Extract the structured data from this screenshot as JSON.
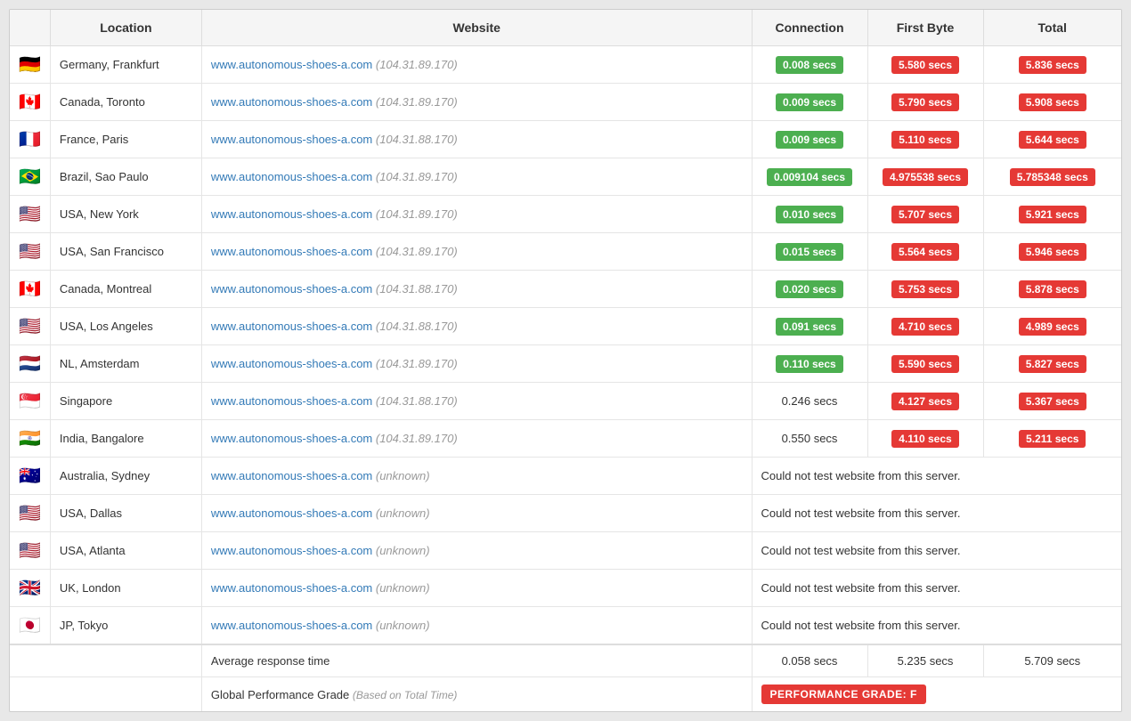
{
  "table": {
    "headers": [
      "",
      "Location",
      "Website",
      "Connection",
      "First Byte",
      "Total"
    ],
    "rows": [
      {
        "flag": "🇩🇪",
        "location": "Germany, Frankfurt",
        "website_main": "www.autonomous-shoes-a.com",
        "website_ip": "(104.31.89.170)",
        "connection": "0.008 secs",
        "connection_type": "green",
        "first_byte": "5.580 secs",
        "first_byte_type": "red",
        "total": "5.836 secs",
        "total_type": "red"
      },
      {
        "flag": "🇨🇦",
        "location": "Canada, Toronto",
        "website_main": "www.autonomous-shoes-a.com",
        "website_ip": "(104.31.89.170)",
        "connection": "0.009 secs",
        "connection_type": "green",
        "first_byte": "5.790 secs",
        "first_byte_type": "red",
        "total": "5.908 secs",
        "total_type": "red"
      },
      {
        "flag": "🇫🇷",
        "location": "France, Paris",
        "website_main": "www.autonomous-shoes-a.com",
        "website_ip": "(104.31.88.170)",
        "connection": "0.009 secs",
        "connection_type": "green",
        "first_byte": "5.110 secs",
        "first_byte_type": "red",
        "total": "5.644 secs",
        "total_type": "red"
      },
      {
        "flag": "🇧🇷",
        "location": "Brazil, Sao Paulo",
        "website_main": "www.autonomous-shoes-a.com",
        "website_ip": "(104.31.89.170)",
        "connection": "0.009104 secs",
        "connection_type": "green",
        "first_byte": "4.975538 secs",
        "first_byte_type": "red",
        "total": "5.785348 secs",
        "total_type": "red"
      },
      {
        "flag": "🇺🇸",
        "location": "USA, New York",
        "website_main": "www.autonomous-shoes-a.com",
        "website_ip": "(104.31.89.170)",
        "connection": "0.010 secs",
        "connection_type": "green",
        "first_byte": "5.707 secs",
        "first_byte_type": "red",
        "total": "5.921 secs",
        "total_type": "red"
      },
      {
        "flag": "🇺🇸",
        "location": "USA, San Francisco",
        "website_main": "www.autonomous-shoes-a.com",
        "website_ip": "(104.31.89.170)",
        "connection": "0.015 secs",
        "connection_type": "green",
        "first_byte": "5.564 secs",
        "first_byte_type": "red",
        "total": "5.946 secs",
        "total_type": "red"
      },
      {
        "flag": "🇨🇦",
        "location": "Canada, Montreal",
        "website_main": "www.autonomous-shoes-a.com",
        "website_ip": "(104.31.88.170)",
        "connection": "0.020 secs",
        "connection_type": "green",
        "first_byte": "5.753 secs",
        "first_byte_type": "red",
        "total": "5.878 secs",
        "total_type": "red"
      },
      {
        "flag": "🇺🇸",
        "location": "USA, Los Angeles",
        "website_main": "www.autonomous-shoes-a.com",
        "website_ip": "(104.31.88.170)",
        "connection": "0.091 secs",
        "connection_type": "green",
        "first_byte": "4.710 secs",
        "first_byte_type": "red",
        "total": "4.989 secs",
        "total_type": "red"
      },
      {
        "flag": "🇳🇱",
        "location": "NL, Amsterdam",
        "website_main": "www.autonomous-shoes-a.com",
        "website_ip": "(104.31.89.170)",
        "connection": "0.110 secs",
        "connection_type": "green",
        "first_byte": "5.590 secs",
        "first_byte_type": "red",
        "total": "5.827 secs",
        "total_type": "red"
      },
      {
        "flag": "🇸🇬",
        "location": "Singapore",
        "website_main": "www.autonomous-shoes-a.com",
        "website_ip": "(104.31.88.170)",
        "connection": "0.246 secs",
        "connection_type": "plain",
        "first_byte": "4.127 secs",
        "first_byte_type": "red",
        "total": "5.367 secs",
        "total_type": "red"
      },
      {
        "flag": "🇮🇳",
        "location": "India, Bangalore",
        "website_main": "www.autonomous-shoes-a.com",
        "website_ip": "(104.31.89.170)",
        "connection": "0.550 secs",
        "connection_type": "plain",
        "first_byte": "4.110 secs",
        "first_byte_type": "red",
        "total": "5.211 secs",
        "total_type": "red"
      },
      {
        "flag": "🇦🇺",
        "location": "Australia, Sydney",
        "website_main": "www.autonomous-shoes-a.com",
        "website_ip": "(unknown)",
        "connection": "",
        "connection_type": "error",
        "error_msg": "Could not test website from this server.",
        "first_byte": "",
        "first_byte_type": "none",
        "total": "",
        "total_type": "none"
      },
      {
        "flag": "🇺🇸",
        "location": "USA, Dallas",
        "website_main": "www.autonomous-shoes-a.com",
        "website_ip": "(unknown)",
        "connection": "",
        "connection_type": "error",
        "error_msg": "Could not test website from this server.",
        "first_byte": "",
        "first_byte_type": "none",
        "total": "",
        "total_type": "none"
      },
      {
        "flag": "🇺🇸",
        "location": "USA, Atlanta",
        "website_main": "www.autonomous-shoes-a.com",
        "website_ip": "(unknown)",
        "connection": "",
        "connection_type": "error",
        "error_msg": "Could not test website from this server.",
        "first_byte": "",
        "first_byte_type": "none",
        "total": "",
        "total_type": "none"
      },
      {
        "flag": "🇬🇧",
        "location": "UK, London",
        "website_main": "www.autonomous-shoes-a.com",
        "website_ip": "(unknown)",
        "connection": "",
        "connection_type": "error",
        "error_msg": "Could not test website from this server.",
        "first_byte": "",
        "first_byte_type": "none",
        "total": "",
        "total_type": "none"
      },
      {
        "flag": "🇯🇵",
        "location": "JP, Tokyo",
        "website_main": "www.autonomous-shoes-a.com",
        "website_ip": "(unknown)",
        "connection": "",
        "connection_type": "error",
        "error_msg": "Could not test website from this server.",
        "first_byte": "",
        "first_byte_type": "none",
        "total": "",
        "total_type": "none"
      }
    ],
    "average": {
      "label": "Average response time",
      "connection": "0.058 secs",
      "first_byte": "5.235 secs",
      "total": "5.709 secs"
    },
    "grade": {
      "label": "Global Performance Grade",
      "based_on": "(Based on Total Time)",
      "badge": "PERFORMANCE GRADE:  F"
    }
  }
}
